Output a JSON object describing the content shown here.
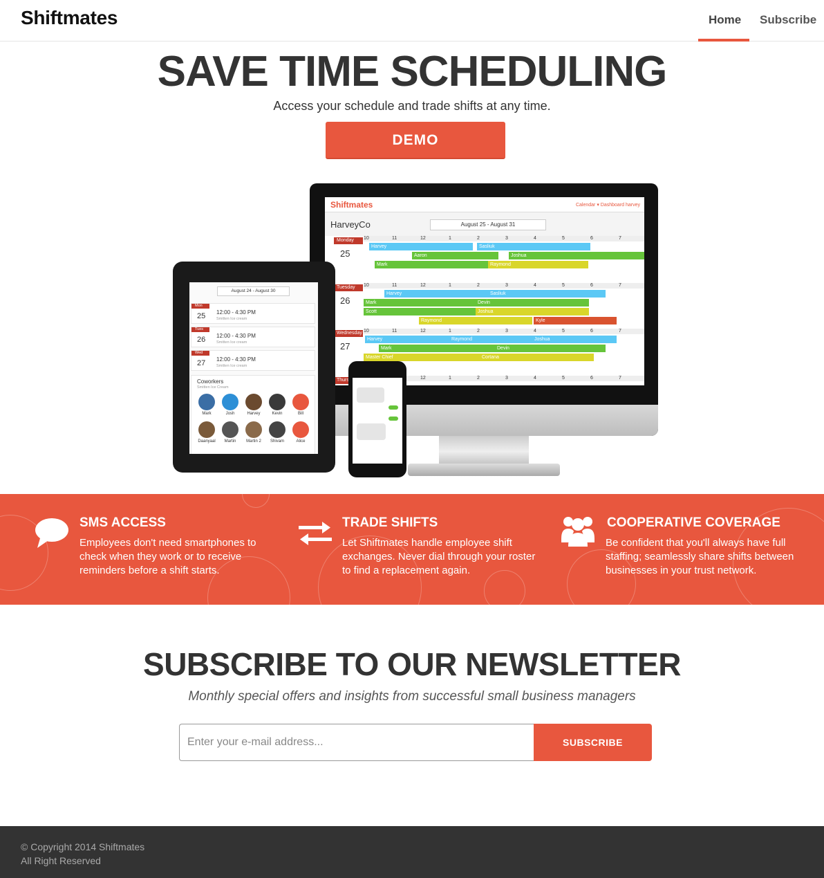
{
  "nav": {
    "brand": "Shiftmates",
    "home": "Home",
    "subscribe": "Subscribe"
  },
  "hero": {
    "title": "SAVE TIME SCHEDULING",
    "subtitle": "Access your schedule and trade shifts at any time.",
    "demo_label": "DEMO"
  },
  "mockup": {
    "logo": "Shiftmates",
    "links": "Calendar ▾     Dashboard     harvey",
    "company": "HarveyCo",
    "range": "August 25 - August 31",
    "days": [
      {
        "label": "Monday",
        "num": "25"
      },
      {
        "label": "Tuesday",
        "num": "26"
      },
      {
        "label": "Wednesday",
        "num": "27"
      },
      {
        "label": "Thursday",
        "num": ""
      }
    ],
    "hours": [
      "10",
      "11",
      "12",
      "1",
      "2",
      "3",
      "4",
      "5",
      "6",
      "7"
    ],
    "tablet_range": "August 24 - August 30",
    "tablet_rows": [
      {
        "day": "Mon",
        "num": "25",
        "time": "12:00 - 4:30 PM",
        "loc": "Smitten Ice cream"
      },
      {
        "day": "Tues",
        "num": "26",
        "time": "12:00 - 4:30 PM",
        "loc": "Smitten Ice cream"
      },
      {
        "day": "Wed",
        "num": "27",
        "time": "12:00 - 4:30 PM",
        "loc": "Smitten Ice cream"
      }
    ],
    "coworkers_title": "Coworkers",
    "coworkers_sub": "Smitten Ice Cream",
    "coworkers": [
      "Mark",
      "Josh",
      "Harvey",
      "Kevin",
      "Bill",
      "Daanyaal",
      "Martin",
      "Martin 2",
      "Shivam",
      "Alice"
    ]
  },
  "features": [
    {
      "title": "SMS ACCESS",
      "icon": "chat-bubble-icon",
      "text": "Employees don't need smartphones to check when they work or to receive reminders before a shift starts."
    },
    {
      "title": "TRADE SHIFTS",
      "icon": "swap-arrows-icon",
      "text": "Let Shiftmates handle employee shift exchanges. Never dial through your roster to find a replacement again."
    },
    {
      "title": "COOPERATIVE COVERAGE",
      "icon": "group-icon",
      "text": "Be confident that you'll always have full staffing; seamlessly share shifts between businesses in your trust network."
    }
  ],
  "newsletter": {
    "title": "SUBSCRIBE TO OUR NEWSLETTER",
    "subtitle": "Monthly special offers and insights from successful small business managers",
    "placeholder": "Enter your e-mail address...",
    "button": "SUBSCRIBE"
  },
  "footer": {
    "copyright": "© Copyright 2014 Shiftmates",
    "rights": "All Right Reserved"
  },
  "colors": {
    "accent": "#e8573e",
    "footer": "#333333"
  }
}
